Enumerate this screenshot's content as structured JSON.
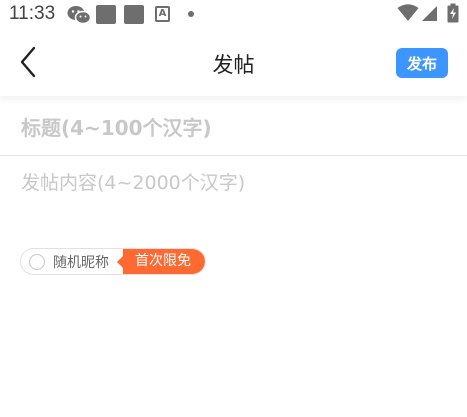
{
  "status_bar": {
    "time": "11:33",
    "icons": [
      "wechat-icon",
      "notification-square-icon",
      "notification-square-icon",
      "a-icon",
      "dot-icon",
      "wifi-icon",
      "signal-icon",
      "battery-charging-icon"
    ]
  },
  "header": {
    "title": "发帖",
    "back_icon": "chevron-left-icon",
    "publish_label": "发布"
  },
  "form": {
    "title_placeholder": "标题(4~100个汉字)",
    "title_value": "",
    "content_placeholder": "发帖内容(4~2000个汉字)",
    "content_value": ""
  },
  "nickname_option": {
    "label": "随机昵称",
    "badge": "首次限免",
    "checked": false
  },
  "colors": {
    "accent": "#3d95ff",
    "badge": "#ff6a33",
    "placeholder": "#c8c8c8"
  }
}
